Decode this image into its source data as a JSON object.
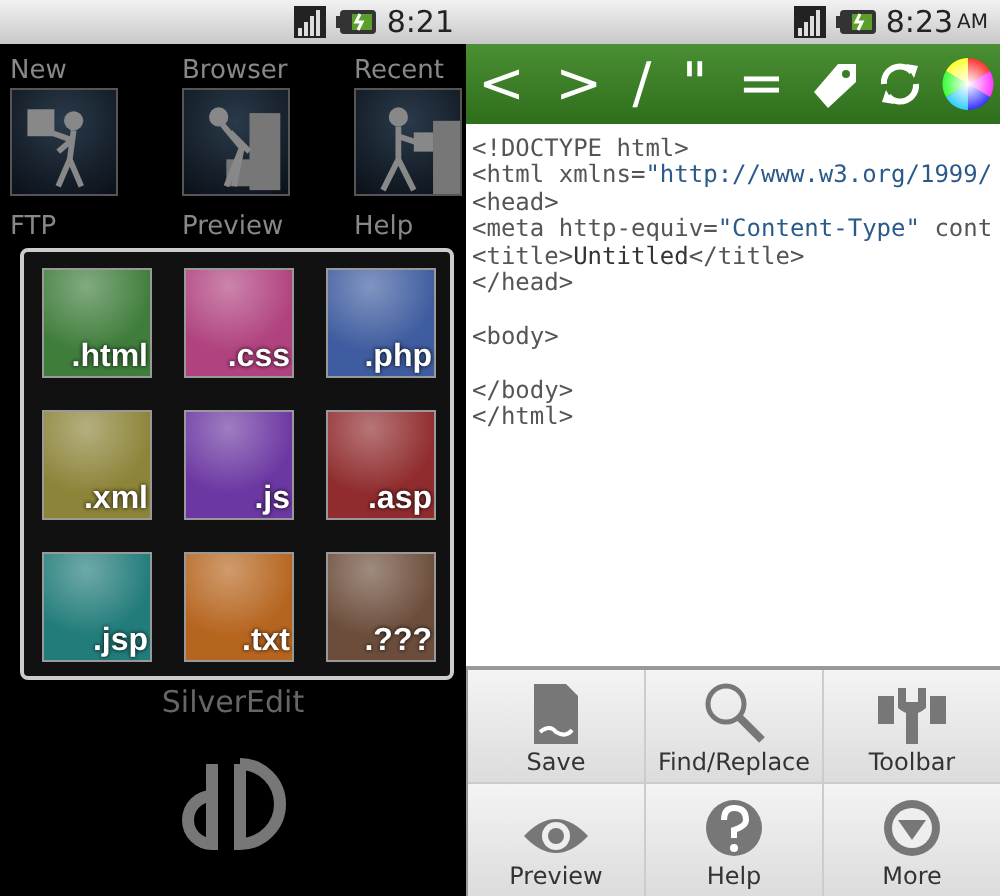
{
  "left_screen": {
    "status_bar": {
      "time": "8:21"
    },
    "home_items": [
      {
        "label": "New",
        "kind": "new"
      },
      {
        "label": "Browser",
        "kind": "browser"
      },
      {
        "label": "Recent",
        "kind": "recent"
      }
    ],
    "home_labels_row_2": [
      "FTP",
      "Preview",
      "Help"
    ],
    "file_type_popup": [
      {
        "label": ".html",
        "color": "#3f7d3b"
      },
      {
        "label": ".css",
        "color": "#b0427f"
      },
      {
        "label": ".php",
        "color": "#3e5c9f"
      },
      {
        "label": ".xml",
        "color": "#8c8439"
      },
      {
        "label": ".js",
        "color": "#6b37a2"
      },
      {
        "label": ".asp",
        "color": "#902c2e"
      },
      {
        "label": ".jsp",
        "color": "#217c7a"
      },
      {
        "label": ".txt",
        "color": "#b6651f"
      },
      {
        "label": ".???",
        "color": "#6c4d3b"
      }
    ],
    "app_name": "SilverEdit"
  },
  "right_screen": {
    "status_bar": {
      "time": "8:23",
      "ampm": "AM"
    },
    "toolbar": [
      {
        "kind": "symbol",
        "label": "<"
      },
      {
        "kind": "symbol",
        "label": ">"
      },
      {
        "kind": "symbol",
        "label": "/"
      },
      {
        "kind": "symbol",
        "label": "\""
      },
      {
        "kind": "symbol",
        "label": "="
      },
      {
        "kind": "tag"
      },
      {
        "kind": "refresh"
      },
      {
        "kind": "color"
      }
    ],
    "code_lines": [
      {
        "blank_before": false,
        "segments": [
          {
            "kind": "markup",
            "text": "<!DOCTYPE html>"
          }
        ]
      },
      {
        "blank_before": false,
        "segments": [
          {
            "kind": "markup",
            "text": "<html xmlns="
          },
          {
            "kind": "value",
            "text": "\"http://www.w3.org/1999/"
          }
        ]
      },
      {
        "blank_before": false,
        "segments": [
          {
            "kind": "markup",
            "text": "<head>"
          }
        ]
      },
      {
        "blank_before": false,
        "segments": [
          {
            "kind": "markup",
            "text": "<meta http-equiv="
          },
          {
            "kind": "value",
            "text": "\"Content-Type\""
          },
          {
            "kind": "markup",
            "text": " cont"
          }
        ]
      },
      {
        "blank_before": false,
        "segments": [
          {
            "kind": "markup",
            "text": "<title>"
          },
          {
            "kind": "plain",
            "text": "Untitled"
          },
          {
            "kind": "markup",
            "text": "</title>"
          }
        ]
      },
      {
        "blank_before": false,
        "segments": [
          {
            "kind": "markup",
            "text": "</head>"
          }
        ]
      },
      {
        "blank_before": true,
        "segments": [
          {
            "kind": "markup",
            "text": "<body>"
          }
        ]
      },
      {
        "blank_before": true,
        "segments": [
          {
            "kind": "markup",
            "text": "</body>"
          }
        ]
      },
      {
        "blank_before": false,
        "segments": [
          {
            "kind": "markup",
            "text": "</html>"
          }
        ]
      }
    ],
    "menu": [
      {
        "label": "Save",
        "kind": "save"
      },
      {
        "label": "Find/Replace",
        "kind": "find"
      },
      {
        "label": "Toolbar",
        "kind": "toolbar"
      },
      {
        "label": "Preview",
        "kind": "preview"
      },
      {
        "label": "Help",
        "kind": "help"
      },
      {
        "label": "More",
        "kind": "more"
      }
    ]
  }
}
